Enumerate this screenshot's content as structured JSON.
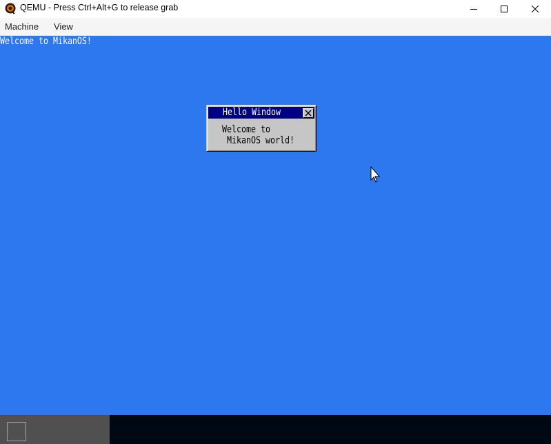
{
  "window": {
    "title": "QEMU - Press Ctrl+Alt+G to release grab",
    "controls": {
      "minimize": "—",
      "maximize": "☐",
      "close": "✕"
    }
  },
  "menubar": {
    "items": [
      "Machine",
      "View"
    ]
  },
  "guest": {
    "background_color": "#2d77ef",
    "console_text": "Welcome to MikanOS!",
    "hello_window": {
      "title": "Hello Window",
      "body_lines": [
        "Welcome to",
        " MikanOS world!"
      ],
      "close_icon": "close-icon"
    },
    "taskbar": {
      "color": "#000814",
      "left_color": "#505050"
    }
  }
}
